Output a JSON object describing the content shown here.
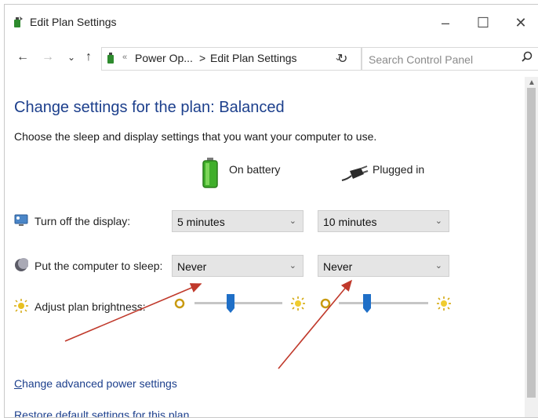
{
  "window": {
    "title": "Edit Plan Settings",
    "controls": {
      "minimize": "–",
      "maximize": "☐",
      "close": "✕"
    }
  },
  "address_bar": {
    "back": "←",
    "forward": "→",
    "recent": "⌄",
    "up": "↑",
    "separator": "«",
    "crumb_1": "Power Op...",
    "crumb_arrow": ">",
    "crumb_2": "Edit Plan Settings",
    "dropdown": "⌄",
    "refresh": "↻",
    "search_placeholder": "Search Control Panel"
  },
  "page": {
    "title": "Change settings for the plan: Balanced",
    "subtitle": "Choose the sleep and display settings that you want your computer to use.",
    "columns": {
      "battery": "On battery",
      "plugged": "Plugged in"
    }
  },
  "settings": [
    {
      "label": "Turn off the display:",
      "on_battery": "5 minutes",
      "plugged_in": "10 minutes"
    },
    {
      "label": "Put the computer to sleep:",
      "on_battery": "Never",
      "plugged_in": "Never"
    }
  ],
  "brightness": {
    "label": "Adjust plan brightness:",
    "on_battery_level": 0.4,
    "plugged_in_level": 0.3
  },
  "links": {
    "advanced_prefix": "C",
    "advanced_rest": "hange advanced power settings",
    "restore_prefix": "R",
    "restore_rest": "estore default settings for this plan"
  },
  "chevron": "⌄",
  "colors": {
    "title_blue": "#1c3f8c",
    "slider_thumb": "#1f6fc7",
    "annotation_red": "#c0392b"
  }
}
